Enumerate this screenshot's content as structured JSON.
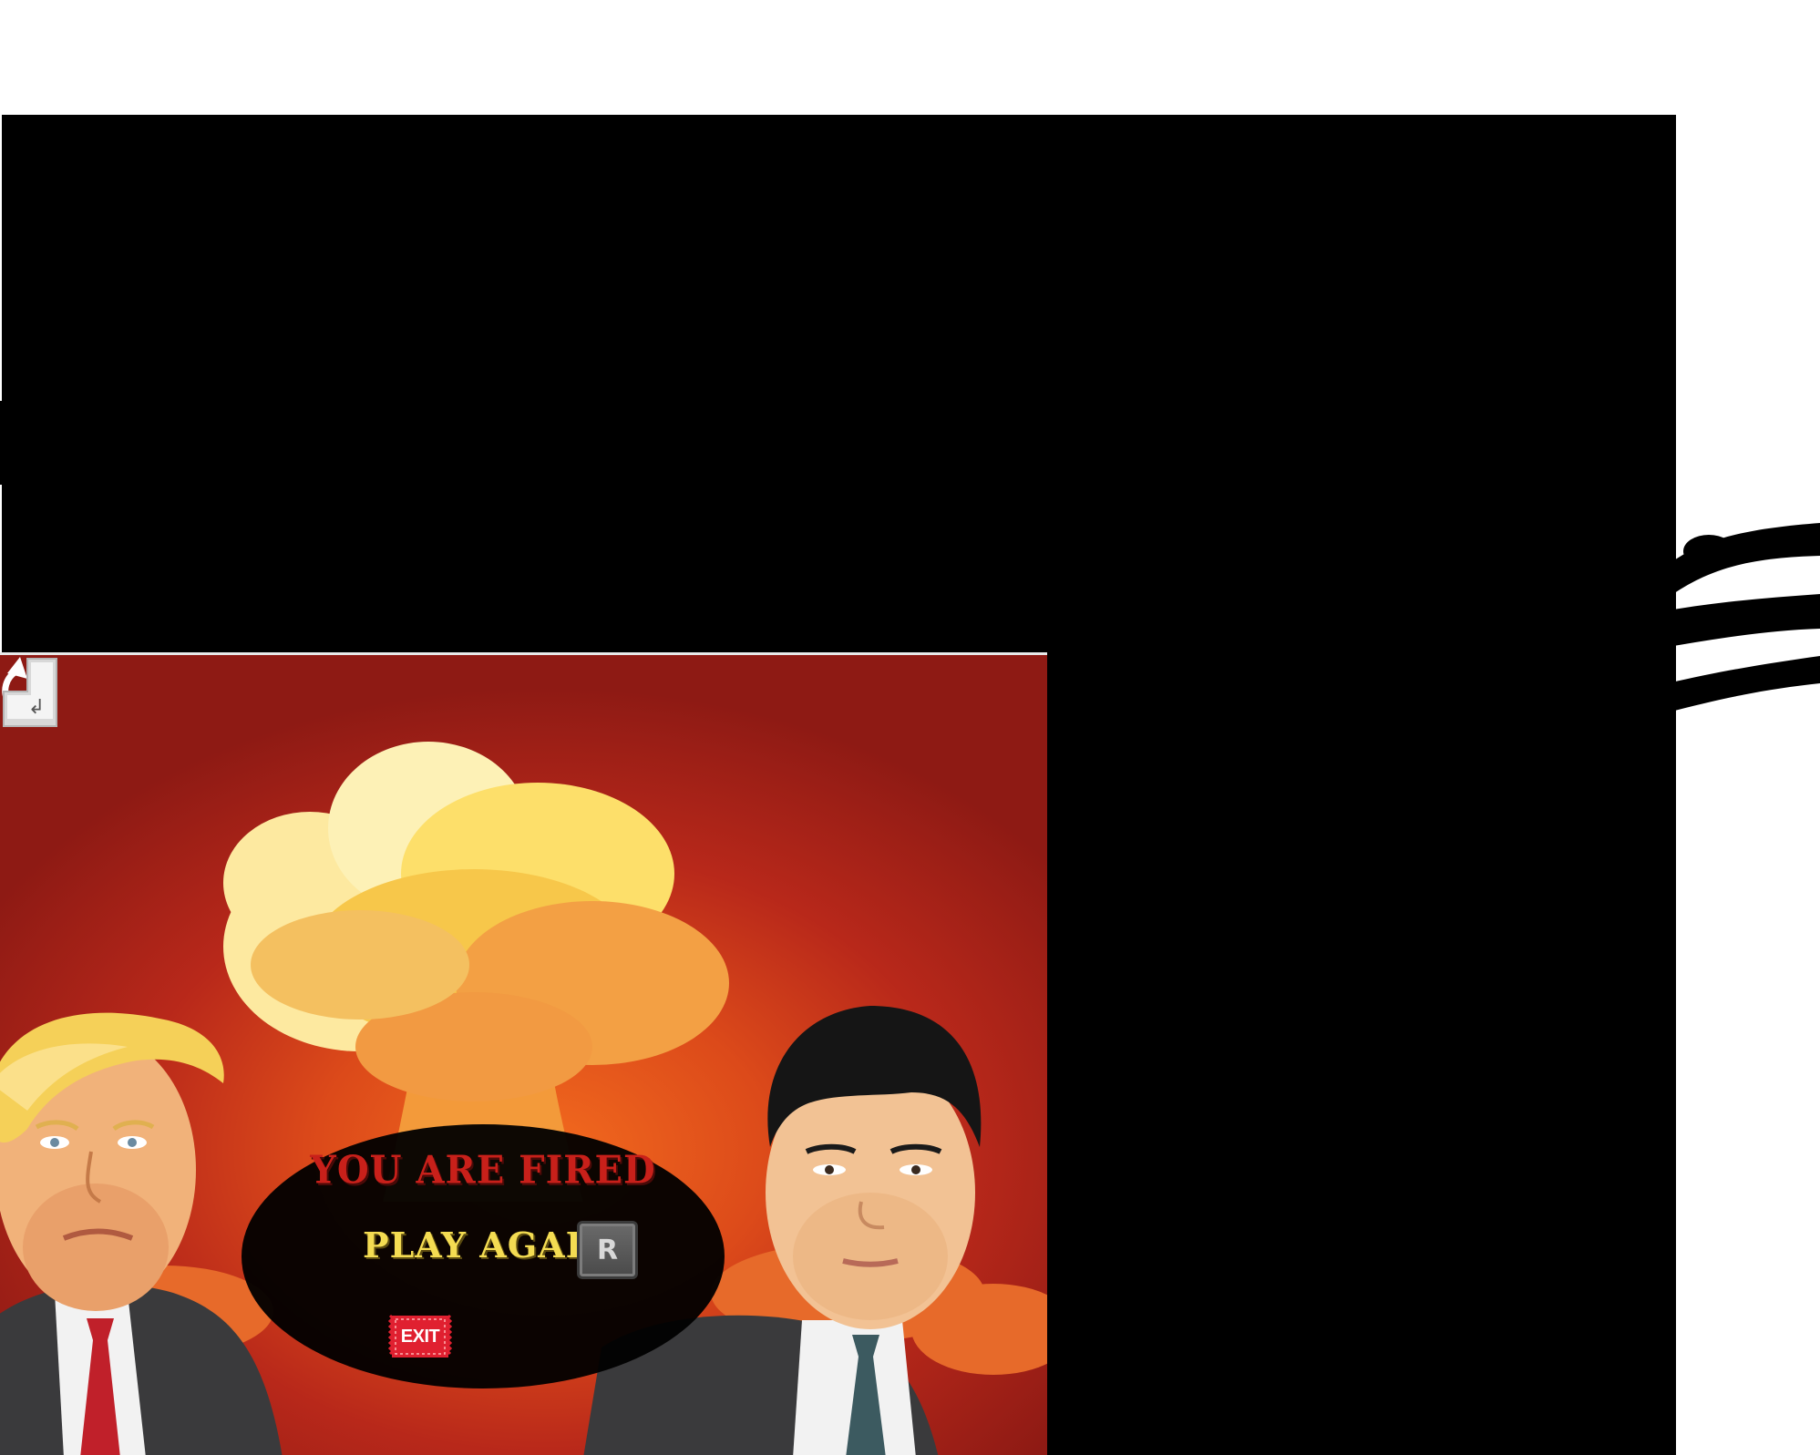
{
  "game_over": {
    "title": "YOU ARE FIRED",
    "play_again_label": "PLAY AGAIN",
    "play_again_key": "R",
    "exit_label": "EXIT",
    "exit_key_symbol": "↲"
  },
  "colors": {
    "title": "#c8201a",
    "play_again": "#f4dc52",
    "exit_badge": "#e02030",
    "sky_center": "#f26a1e",
    "sky_edge": "#8e1a14"
  },
  "icons": {
    "replay": "replay-icon",
    "key_r": "keyboard-key-icon",
    "exit": "exit-badge-icon",
    "enter": "enter-key-icon"
  }
}
